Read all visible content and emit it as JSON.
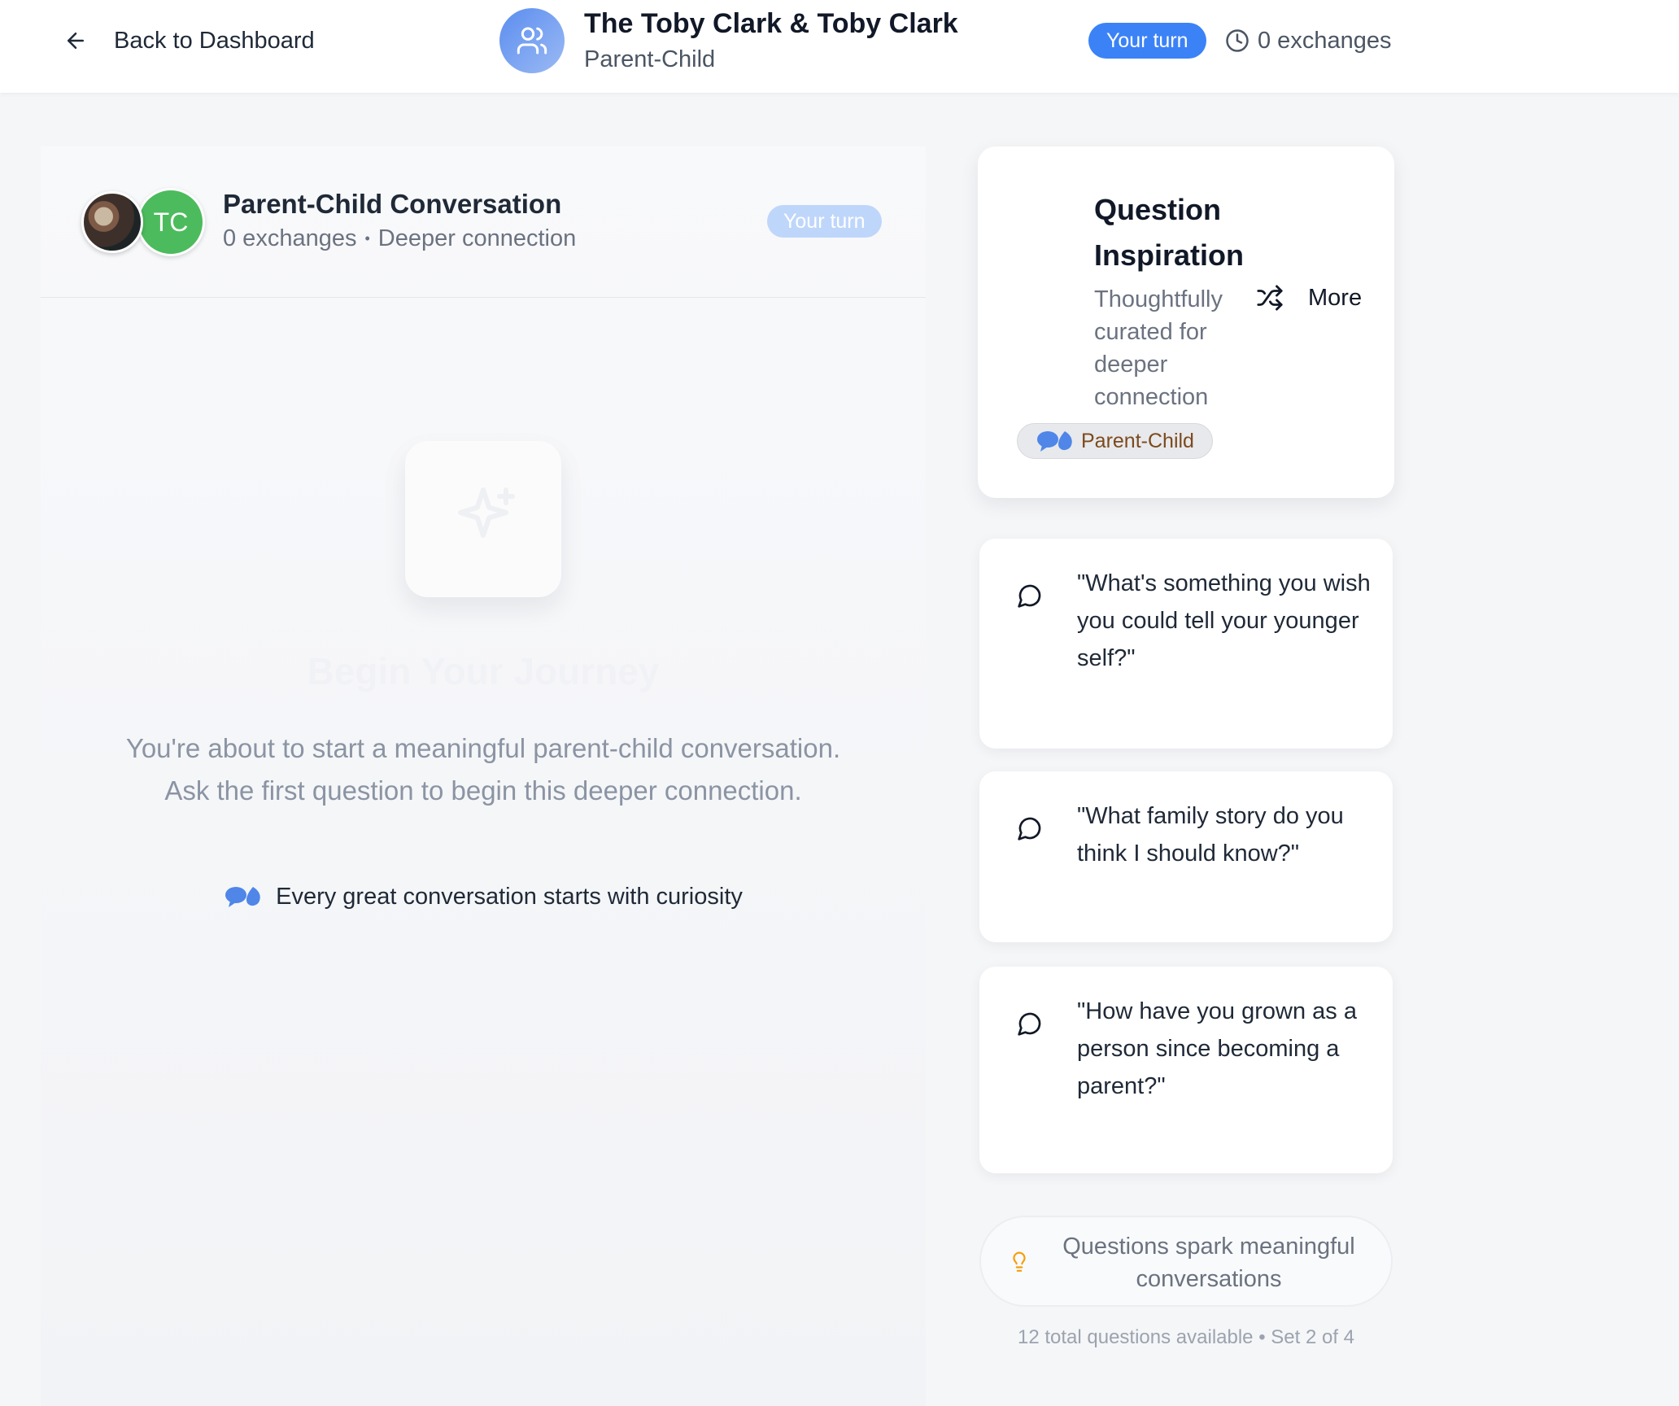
{
  "header": {
    "back_label": "Back to Dashboard",
    "title": "The Toby Clark & Toby Clark",
    "subtitle": "Parent-Child",
    "turn_badge": "Your turn",
    "exchanges": "0 exchanges"
  },
  "conversation": {
    "avatar_initials": "TC",
    "title": "Parent-Child Conversation",
    "exchanges": "0 exchanges",
    "separator": "•",
    "tagline": "Deeper connection",
    "turn_badge": "Your turn",
    "empty_title": "Begin Your Journey",
    "empty_description": "You're about to start a meaningful parent-child conversation. Ask the first question to begin this deeper connection.",
    "note": "Every great conversation starts with curiosity"
  },
  "inspiration": {
    "title": "Question Inspiration",
    "subtitle": "Thoughtfully curated for deeper connection",
    "more_label": "More",
    "category_tag": "Parent-Child",
    "questions": [
      "\"What's something you wish you could tell your younger self?\"",
      "\"What family story do you think I should know?\"",
      "\"How have you grown as a person since becoming a parent?\""
    ],
    "tip": "Questions spark meaningful conversations",
    "footer": "12 total questions available • Set 2 of 4"
  },
  "colors": {
    "accent": "#3b82f6",
    "avatar_green": "#4cbb5d",
    "tag_text": "#7c4a1e",
    "bulb": "#f59e0b"
  },
  "icons": {
    "back": "arrow-left-icon",
    "conversation": "users-icon",
    "exchanges": "clock-icon",
    "empty_state": "sparkles-icon",
    "note": "speech-bubbles-icon",
    "more": "shuffle-icon",
    "question": "message-circle-icon",
    "tip": "lightbulb-icon"
  }
}
